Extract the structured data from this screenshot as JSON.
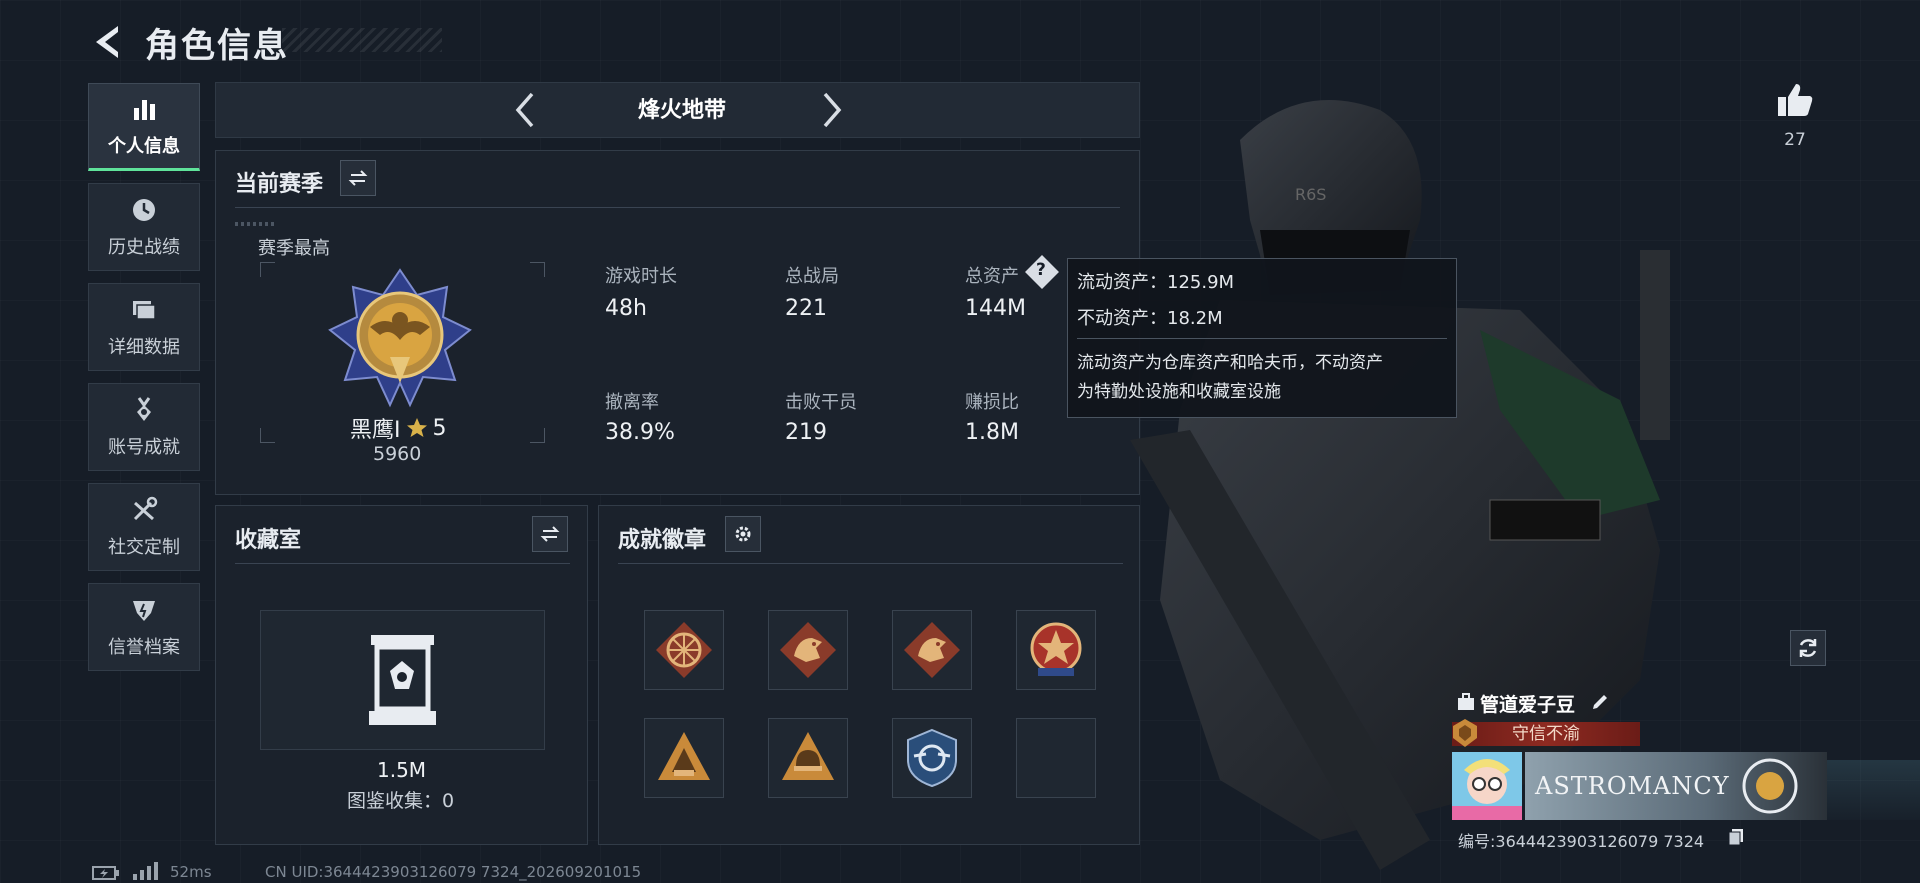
{
  "header": {
    "title": "角色信息"
  },
  "sidebar": {
    "items": [
      {
        "label": "个人信息",
        "icon": "bar-chart-icon",
        "active": true
      },
      {
        "label": "历史战绩",
        "icon": "clock-icon"
      },
      {
        "label": "详细数据",
        "icon": "folder-icon"
      },
      {
        "label": "账号成就",
        "icon": "medal-icon"
      },
      {
        "label": "社交定制",
        "icon": "tools-icon"
      },
      {
        "label": "信誉档案",
        "icon": "shield-icon"
      }
    ]
  },
  "mode": {
    "name": "烽火地带"
  },
  "season": {
    "title": "当前赛季",
    "best_label": "赛季最高",
    "rank_name": "黑鹰I",
    "rank_stars": "5",
    "rank_score": "5960",
    "stats": [
      {
        "label": "游戏时长",
        "value": "48h"
      },
      {
        "label": "总战局",
        "value": "221"
      },
      {
        "label": "总资产",
        "value": "144M"
      },
      {
        "label": "撤离率",
        "value": "38.9%"
      },
      {
        "label": "击败干员",
        "value": "219"
      },
      {
        "label": "赚损比",
        "value": "1.8M"
      }
    ]
  },
  "tooltip": {
    "line1": "流动资产：125.9M",
    "line2": "不动资产：18.2M",
    "desc1": "流动资产为仓库资产和哈夫币，不动资产",
    "desc2": "为特勤处设施和收藏室设施"
  },
  "collection": {
    "title": "收藏室",
    "value": "1.5M",
    "catalog": "图鉴收集：0"
  },
  "badges": {
    "title": "成就徽章",
    "items": [
      "wheel-emblem-icon",
      "dragon-emblem-icon",
      "dragon-emblem-icon",
      "star-medal-icon",
      "pyramid-emblem-icon",
      "helmet-emblem-icon",
      "wings-emblem-icon",
      "empty-slot"
    ]
  },
  "profile": {
    "likes": "27",
    "name": "管道爱子豆",
    "reputation": "守信不渝",
    "banner_text": "ASTROMANCY",
    "uid": "编号:3644423903126079 7324"
  },
  "footer": {
    "ping": "52ms",
    "uid": "CN UID:3644423903126079 7324_202609201015"
  },
  "colors": {
    "accent_green": "#5fe39a",
    "gold": "#d9a441",
    "rep_red": "#8e2a21"
  }
}
